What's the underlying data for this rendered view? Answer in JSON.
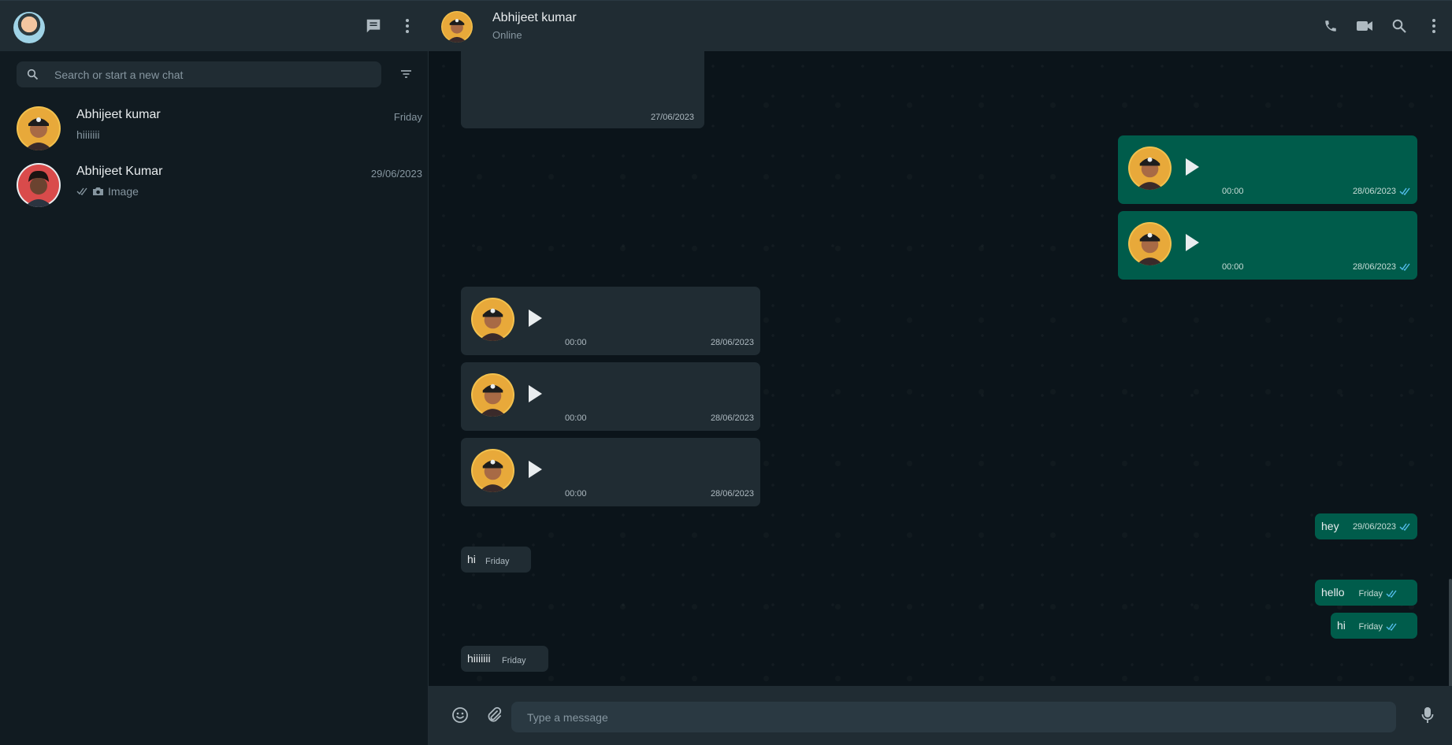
{
  "sidebar": {
    "search": {
      "placeholder": "Search or start a new chat"
    },
    "chats": [
      {
        "name": "Abhijeet kumar",
        "time": "Friday",
        "last_message": "hiiiiiii"
      },
      {
        "name": "Abhijeet Kumar",
        "time": "29/06/2023",
        "last_message": "Image"
      }
    ]
  },
  "conversation": {
    "contact_name": "Abhijeet kumar",
    "status": "Online",
    "messages": [
      {
        "type": "image",
        "direction": "in",
        "time": "27/06/2023"
      },
      {
        "type": "voice",
        "direction": "out",
        "duration": "00:00",
        "time": "28/06/2023",
        "read": true
      },
      {
        "type": "voice",
        "direction": "out",
        "duration": "00:00",
        "time": "28/06/2023",
        "read": true
      },
      {
        "type": "voice",
        "direction": "in",
        "duration": "00:00",
        "time": "28/06/2023"
      },
      {
        "type": "voice",
        "direction": "in",
        "duration": "00:00",
        "time": "28/06/2023"
      },
      {
        "type": "voice",
        "direction": "in",
        "duration": "00:00",
        "time": "28/06/2023"
      },
      {
        "type": "text",
        "direction": "out",
        "text": "hey",
        "time": "29/06/2023",
        "read": true
      },
      {
        "type": "text",
        "direction": "in",
        "text": "hi",
        "time": "Friday"
      },
      {
        "type": "text",
        "direction": "out",
        "text": "hello",
        "time": "Friday",
        "read": true
      },
      {
        "type": "text",
        "direction": "out",
        "text": "hi",
        "time": "Friday",
        "read": true
      },
      {
        "type": "text",
        "direction": "in",
        "text": "hiiiiiii",
        "time": "Friday"
      }
    ]
  },
  "composer": {
    "placeholder": "Type a message"
  },
  "icons": {
    "header": [
      "new-chat-icon",
      "menu-icon"
    ],
    "conversation_header": [
      "phone-icon",
      "video-icon",
      "search-icon",
      "menu-icon"
    ],
    "composer": [
      "emoji-icon",
      "attach-icon",
      "mic-icon"
    ]
  },
  "colors": {
    "outgoing": "#005c4b",
    "incoming": "#202c33",
    "read_ticks": "#53bdeb",
    "panel": "#111b21",
    "header": "#202c33"
  }
}
